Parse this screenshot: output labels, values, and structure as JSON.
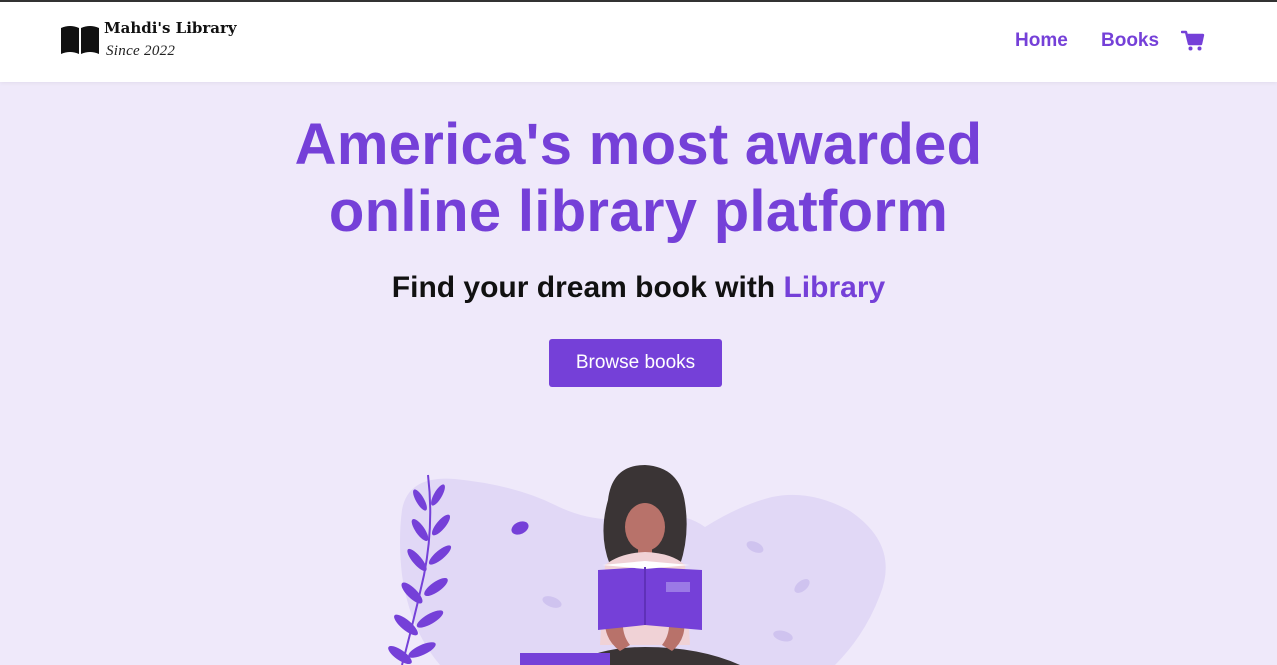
{
  "header": {
    "brand_name": "Mahdi's Library",
    "brand_tagline": "Since 2022",
    "nav": {
      "home_label": "Home",
      "books_label": "Books"
    },
    "icons": {
      "logo": "open-book-icon",
      "cart": "shopping-cart-icon"
    }
  },
  "hero": {
    "title_line1": "America's most awarded",
    "title_line2": "online library platform",
    "subtitle_prefix": "Find your dream book with",
    "subtitle_accent": "Library",
    "cta_label": "Browse books"
  },
  "colors": {
    "accent": "#7540d8",
    "page_background": "#efe9fa",
    "header_background": "#ffffff",
    "text_dark": "#111111"
  }
}
